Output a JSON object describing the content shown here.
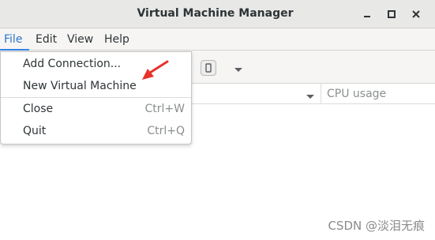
{
  "window": {
    "title": "Virtual Machine Manager"
  },
  "window_controls": {
    "minimize_icon": "minimize-icon",
    "maximize_icon": "maximize-icon",
    "close_icon": "close-icon"
  },
  "menubar": {
    "items": [
      {
        "label": "File",
        "active": true
      },
      {
        "label": "Edit"
      },
      {
        "label": "View"
      },
      {
        "label": "Help"
      }
    ]
  },
  "toolbar": {
    "buttons": [
      "vm-details-icon",
      "dropdown-arrow-icon"
    ]
  },
  "table": {
    "columns": [
      "CPU usage"
    ]
  },
  "file_menu": {
    "items": [
      {
        "label": "Add Connection...",
        "accel": ""
      },
      {
        "label": "New Virtual Machine",
        "accel": ""
      },
      {
        "label": "Close",
        "accel": "Ctrl+W"
      },
      {
        "label": "Quit",
        "accel": "Ctrl+Q"
      }
    ]
  },
  "annotation": {
    "arrow_color": "#e8322a"
  },
  "watermark": "CSDN @淡泪无痕",
  "colors": {
    "accent": "#3584e4",
    "titlebar": "#e8e8e7",
    "menubar": "#f6f5f4"
  }
}
